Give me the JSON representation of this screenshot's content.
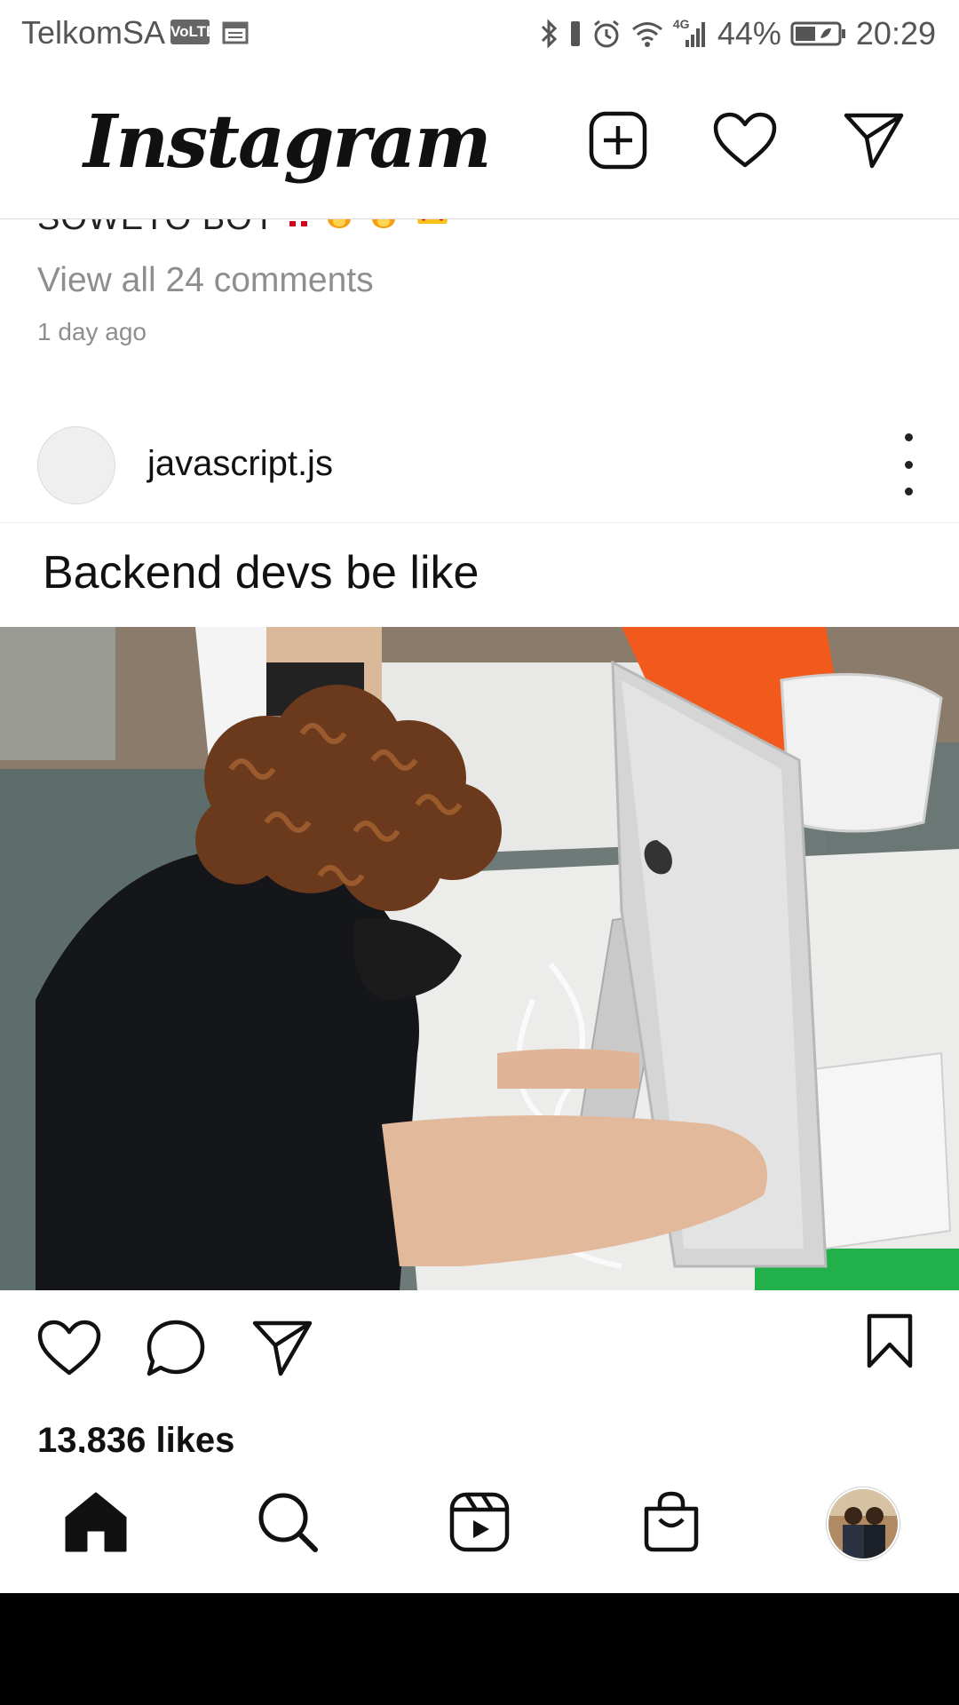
{
  "status_bar": {
    "carrier": "TelkomSA",
    "volte": "VoLTE",
    "network": "4G",
    "battery": "44%",
    "time": "20:29"
  },
  "app": {
    "logo": "Instagram"
  },
  "feed": {
    "prev_post": {
      "caption_cut": "SOWETO BOY",
      "view_comments": "View all 24 comments",
      "time_ago": "1 day ago"
    },
    "post": {
      "username": "javascript.js",
      "meme_text": "Backend devs be like",
      "likes": "13,836 likes"
    }
  },
  "icons": {
    "new_post": "plus-square-icon",
    "activity": "heart-icon",
    "direct": "paper-plane-icon",
    "like": "heart-icon",
    "comment": "speech-bubble-icon",
    "share": "paper-plane-icon",
    "save": "bookmark-icon",
    "home": "home-icon",
    "search": "search-icon",
    "reels": "reels-icon",
    "shop": "shopping-bag-icon",
    "profile": "profile-avatar"
  },
  "colors": {
    "text": "#262626",
    "secondary": "#8e8e8e",
    "divider": "#dbdbdb",
    "background": "#ffffff"
  }
}
